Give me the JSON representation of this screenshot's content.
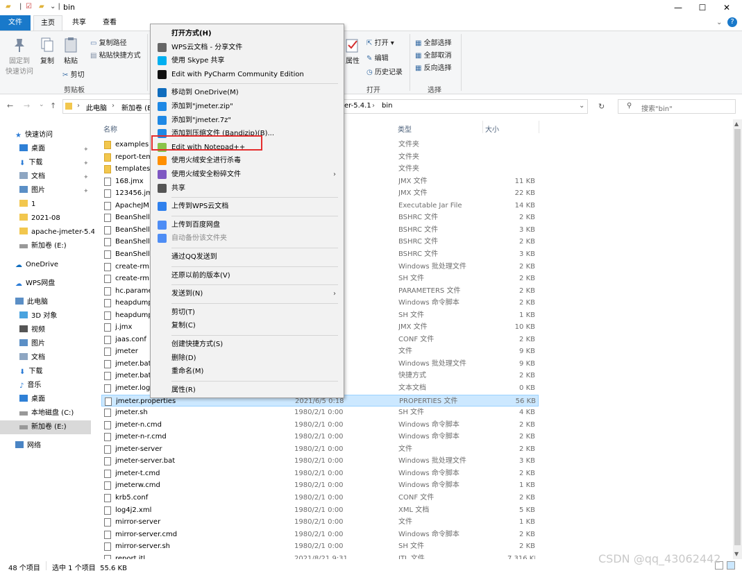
{
  "titlebar": {
    "title": "bin",
    "min": "—",
    "max": "☐",
    "close": "✕"
  },
  "ribbon_tabs": {
    "file": "文件",
    "home": "主页",
    "share": "共享",
    "view": "查看"
  },
  "ribbon": {
    "pin_quick": "固定到\n快速访问",
    "copy": "复制",
    "paste": "粘贴",
    "copy_path": "复制路径",
    "paste_shortcut": "粘贴快捷方式",
    "cut": "剪切",
    "clipboard_group": "剪贴板",
    "properties": "属性",
    "open": "打开",
    "edit": "编辑",
    "history": "历史记录",
    "open_group": "打开",
    "select_all": "全部选择",
    "select_none": "全部取消",
    "invert": "反向选择",
    "select_group": "选择"
  },
  "address": {
    "crumbs": [
      "此电脑",
      "›",
      "新加卷 (E",
      "er-5.4.1",
      "›",
      "bin"
    ],
    "search_placeholder": "搜索\"bin\"",
    "refresh": "↻",
    "dropdown": "⌄"
  },
  "nav": {
    "items": [
      {
        "label": "快速访问",
        "icon": "star-icon"
      },
      {
        "label": "桌面",
        "icon": "desktop-icon"
      },
      {
        "label": "下载",
        "icon": "download-icon"
      },
      {
        "label": "文档",
        "icon": "document-icon"
      },
      {
        "label": "图片",
        "icon": "picture-icon"
      },
      {
        "label": "1",
        "icon": "folder-icon"
      },
      {
        "label": "2021-08",
        "icon": "folder-icon"
      },
      {
        "label": "apache-jmeter-5.4",
        "icon": "folder-icon"
      },
      {
        "label": "新加卷 (E:)",
        "icon": "drive-icon"
      },
      {
        "label": "OneDrive",
        "icon": "cloud-icon"
      },
      {
        "label": "WPS网盘",
        "icon": "cloud-icon"
      },
      {
        "label": "此电脑",
        "icon": "computer-icon"
      },
      {
        "label": "3D 对象",
        "icon": "cube-icon"
      },
      {
        "label": "视频",
        "icon": "video-icon"
      },
      {
        "label": "图片",
        "icon": "picture-icon"
      },
      {
        "label": "文档",
        "icon": "document-icon"
      },
      {
        "label": "下载",
        "icon": "download-icon"
      },
      {
        "label": "音乐",
        "icon": "music-icon"
      },
      {
        "label": "桌面",
        "icon": "desktop-icon"
      },
      {
        "label": "本地磁盘 (C:)",
        "icon": "drive-icon"
      },
      {
        "label": "新加卷 (E:)",
        "icon": "drive-icon"
      },
      {
        "label": "网络",
        "icon": "network-icon"
      }
    ]
  },
  "columns": {
    "name": "名称",
    "type": "类型",
    "size": "大小"
  },
  "files": [
    {
      "name": "examples",
      "date": "",
      "type": "文件夹",
      "size": "",
      "folder": true
    },
    {
      "name": "report-tem",
      "date": "",
      "type": "文件夹",
      "size": "",
      "folder": true
    },
    {
      "name": "templates",
      "date": "",
      "type": "文件夹",
      "size": "",
      "folder": true
    },
    {
      "name": "168.jmx",
      "date": "5",
      "type": "JMX 文件",
      "size": "11 KB"
    },
    {
      "name": "123456.jm",
      "date": "",
      "type": "JMX 文件",
      "size": "22 KB"
    },
    {
      "name": "ApacheJM",
      "date": "",
      "type": "Executable Jar File",
      "size": "14 KB"
    },
    {
      "name": "BeanShellA",
      "date": "",
      "type": "BSHRC 文件",
      "size": "2 KB"
    },
    {
      "name": "BeanShellF",
      "date": "",
      "type": "BSHRC 文件",
      "size": "3 KB"
    },
    {
      "name": "BeanShellL",
      "date": "",
      "type": "BSHRC 文件",
      "size": "2 KB"
    },
    {
      "name": "BeanShellS",
      "date": "",
      "type": "BSHRC 文件",
      "size": "3 KB"
    },
    {
      "name": "create-rmi",
      "date": "",
      "type": "Windows 批处理文件",
      "size": "2 KB"
    },
    {
      "name": "create-rmi",
      "date": "",
      "type": "SH 文件",
      "size": "2 KB"
    },
    {
      "name": "hc.parame",
      "date": "",
      "type": "PARAMETERS 文件",
      "size": "2 KB"
    },
    {
      "name": "heapdump",
      "date": "",
      "type": "Windows 命令脚本",
      "size": "2 KB"
    },
    {
      "name": "heapdump",
      "date": "",
      "type": "SH 文件",
      "size": "1 KB"
    },
    {
      "name": "j.jmx",
      "date": "",
      "type": "JMX 文件",
      "size": "10 KB"
    },
    {
      "name": "jaas.conf",
      "date": "",
      "type": "CONF 文件",
      "size": "2 KB"
    },
    {
      "name": "jmeter",
      "date": "",
      "type": "文件",
      "size": "9 KB"
    },
    {
      "name": "jmeter.bat",
      "date": "",
      "type": "Windows 批处理文件",
      "size": "9 KB"
    },
    {
      "name": "jmeter.bat",
      "date": "",
      "type": "快捷方式",
      "size": "2 KB"
    },
    {
      "name": "jmeter.log",
      "date": "3",
      "type": "文本文档",
      "size": "0 KB"
    },
    {
      "name": "jmeter.properties",
      "date": "2021/6/5 0:18",
      "type": "PROPERTIES 文件",
      "size": "56 KB",
      "selected": true
    },
    {
      "name": "jmeter.sh",
      "date": "1980/2/1 0:00",
      "type": "SH 文件",
      "size": "4 KB"
    },
    {
      "name": "jmeter-n.cmd",
      "date": "1980/2/1 0:00",
      "type": "Windows 命令脚本",
      "size": "2 KB"
    },
    {
      "name": "jmeter-n-r.cmd",
      "date": "1980/2/1 0:00",
      "type": "Windows 命令脚本",
      "size": "2 KB"
    },
    {
      "name": "jmeter-server",
      "date": "1980/2/1 0:00",
      "type": "文件",
      "size": "2 KB"
    },
    {
      "name": "jmeter-server.bat",
      "date": "1980/2/1 0:00",
      "type": "Windows 批处理文件",
      "size": "3 KB"
    },
    {
      "name": "jmeter-t.cmd",
      "date": "1980/2/1 0:00",
      "type": "Windows 命令脚本",
      "size": "2 KB"
    },
    {
      "name": "jmeterw.cmd",
      "date": "1980/2/1 0:00",
      "type": "Windows 命令脚本",
      "size": "1 KB"
    },
    {
      "name": "krb5.conf",
      "date": "1980/2/1 0:00",
      "type": "CONF 文件",
      "size": "2 KB"
    },
    {
      "name": "log4j2.xml",
      "date": "1980/2/1 0:00",
      "type": "XML 文档",
      "size": "5 KB"
    },
    {
      "name": "mirror-server",
      "date": "1980/2/1 0:00",
      "type": "文件",
      "size": "1 KB"
    },
    {
      "name": "mirror-server.cmd",
      "date": "1980/2/1 0:00",
      "type": "Windows 命令脚本",
      "size": "2 KB"
    },
    {
      "name": "mirror-server.sh",
      "date": "1980/2/1 0:00",
      "type": "SH 文件",
      "size": "2 KB"
    },
    {
      "name": "report.jtl",
      "date": "2021/8/21 9:31",
      "type": "JTL 文件",
      "size": "7,316 KB"
    }
  ],
  "context_menu": {
    "items": [
      {
        "label": "打开方式(H)",
        "icon": "",
        "bold": true
      },
      {
        "label": "WPS云文档 - 分享文件",
        "icon": "share-icon",
        "color": "#666666"
      },
      {
        "label": "使用 Skype 共享",
        "icon": "skype-icon",
        "color": "#00aff0"
      },
      {
        "label": "Edit with PyCharm Community Edition",
        "icon": "pycharm-icon",
        "color": "#111111"
      },
      {
        "sep": true
      },
      {
        "label": "移动到 OneDrive(M)",
        "icon": "onedrive-icon",
        "color": "#0f6cbd"
      },
      {
        "label": "添加到\"jmeter.zip\"",
        "icon": "bandizip-icon",
        "color": "#1e88e5"
      },
      {
        "label": "添加到\"jmeter.7z\"",
        "icon": "bandizip-icon",
        "color": "#1e88e5"
      },
      {
        "label": "添加到压缩文件 (Bandizip)(B)...",
        "icon": "bandizip-icon",
        "color": "#1e88e5"
      },
      {
        "label": "Edit with Notepad++",
        "icon": "notepadpp-icon",
        "color": "#8bc34a"
      },
      {
        "label": "使用火绒安全进行杀毒",
        "icon": "huorong-icon",
        "color": "#ff8f00"
      },
      {
        "label": "使用火绒安全粉碎文件",
        "icon": "shred-icon",
        "color": "#7e57c2",
        "arrow": true
      },
      {
        "label": "共享",
        "icon": "share-arrow-icon",
        "color": "#555555"
      },
      {
        "sep": true
      },
      {
        "label": "上传到WPS云文档",
        "icon": "wps-cloud-icon",
        "color": "#2f80ed"
      },
      {
        "sep": true
      },
      {
        "label": "上传到百度网盘",
        "icon": "baidu-icon",
        "color": "#4e8df5"
      },
      {
        "label": "自动备份该文件夹",
        "icon": "baidu-icon",
        "color": "#4e8df5",
        "gray": true
      },
      {
        "sep": true
      },
      {
        "label": "通过QQ发送到",
        "icon": "",
        "color": ""
      },
      {
        "sep": true
      },
      {
        "label": "还原以前的版本(V)",
        "icon": "",
        "color": ""
      },
      {
        "sep": true
      },
      {
        "label": "发送到(N)",
        "icon": "",
        "color": "",
        "arrow": true
      },
      {
        "sep": true
      },
      {
        "label": "剪切(T)",
        "icon": "",
        "color": ""
      },
      {
        "label": "复制(C)",
        "icon": "",
        "color": ""
      },
      {
        "sep": true
      },
      {
        "label": "创建快捷方式(S)",
        "icon": "",
        "color": ""
      },
      {
        "label": "删除(D)",
        "icon": "",
        "color": ""
      },
      {
        "label": "重命名(M)",
        "icon": "",
        "color": ""
      },
      {
        "sep": true
      },
      {
        "label": "属性(R)",
        "icon": "",
        "color": ""
      }
    ]
  },
  "status": {
    "count": "48 个项目",
    "selected": "选中 1 个项目  55.6 KB"
  },
  "watermark": "CSDN @qq_43062442",
  "colors": {
    "accent": "#1979ca",
    "selection": "#cce8ff",
    "highlight_box": "#e52d2d"
  }
}
